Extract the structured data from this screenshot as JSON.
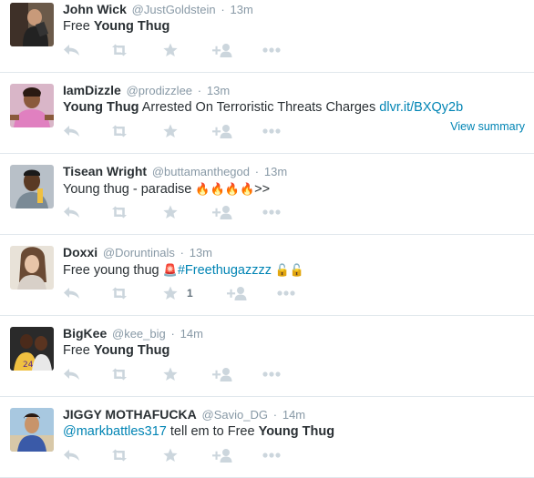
{
  "tweets": [
    {
      "fullname": "John Wick",
      "username": "@JustGoldstein",
      "dot": "·",
      "time": "13m",
      "text_parts": [
        {
          "t": "Free ",
          "style": "plain"
        },
        {
          "t": "Young Thug",
          "style": "bold"
        }
      ],
      "favorite_count": ""
    },
    {
      "fullname": "IamDizzle",
      "username": "@prodizzlee",
      "dot": "·",
      "time": "13m",
      "text_parts": [
        {
          "t": "Young Thug",
          "style": "bold"
        },
        {
          "t": " Arrested On Terroristic Threats Charges ",
          "style": "plain"
        },
        {
          "t": "dlvr.it/BXQy2b",
          "style": "link"
        }
      ],
      "view_summary": "View summary",
      "favorite_count": ""
    },
    {
      "fullname": "Tisean Wright",
      "username": "@buttamanthegod",
      "dot": "·",
      "time": "13m",
      "text_parts": [
        {
          "t": "Young thug - paradise ",
          "style": "plain"
        },
        {
          "t": "🔥🔥🔥🔥",
          "style": "emoji"
        },
        {
          "t": ">>",
          "style": "plain"
        }
      ],
      "favorite_count": ""
    },
    {
      "fullname": "Doxxi",
      "username": "@Doruntinals",
      "dot": "·",
      "time": "13m",
      "text_parts": [
        {
          "t": "Free young thug  ",
          "style": "plain"
        },
        {
          "t": "🚨",
          "style": "emoji"
        },
        {
          "t": "#Freethugazzzz",
          "style": "link"
        },
        {
          "t": " 🔓🔓",
          "style": "emoji"
        }
      ],
      "favorite_count": "1"
    },
    {
      "fullname": "BigKee",
      "username": "@kee_big",
      "dot": "·",
      "time": "14m",
      "text_parts": [
        {
          "t": "Free ",
          "style": "plain"
        },
        {
          "t": "Young Thug",
          "style": "bold"
        }
      ],
      "favorite_count": ""
    },
    {
      "fullname": "JIGGY MOTHAFUCKA",
      "username": "@Savio_DG",
      "dot": "·",
      "time": "14m",
      "text_parts": [
        {
          "t": "@markbattles317",
          "style": "link"
        },
        {
          "t": " tell em to Free ",
          "style": "plain"
        },
        {
          "t": "Young Thug",
          "style": "bold"
        }
      ],
      "favorite_count": ""
    }
  ],
  "icons": {
    "reply": "reply-icon",
    "retweet": "retweet-icon",
    "favorite": "star-icon",
    "follow": "follow-icon",
    "more": "more-icon"
  },
  "colors": {
    "action_icon": "#ccd6dd",
    "link": "#0084b4",
    "secondary_text": "#8899a6",
    "border": "#e1e8ed"
  }
}
